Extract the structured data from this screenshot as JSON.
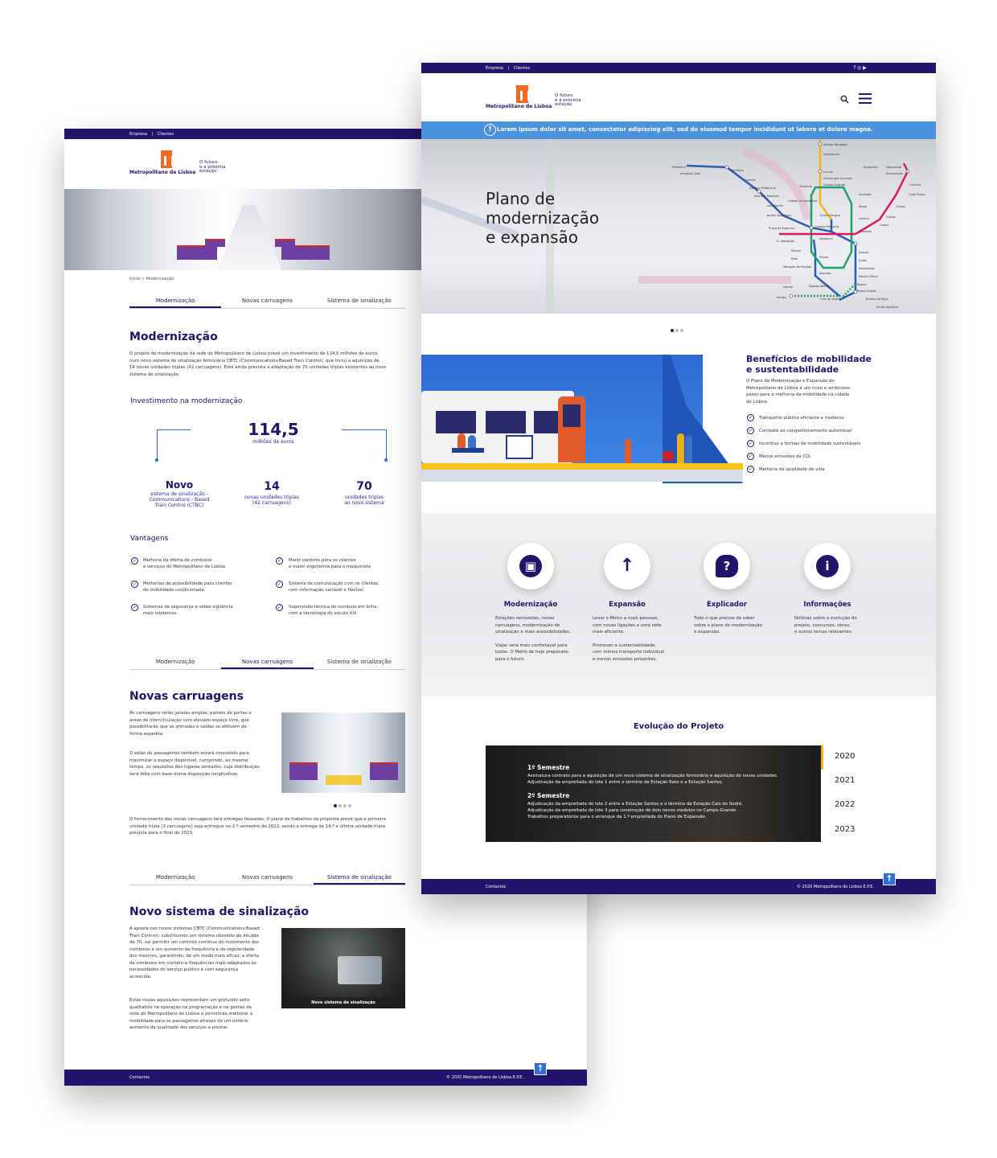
{
  "back": {
    "topbar": {
      "empresa": "Empresa",
      "sep": "|",
      "clientes": "Clientes"
    },
    "logo": {
      "name": "Metropolitano de Lisboa",
      "slogan_1": "O futuro",
      "slogan_2": "é a próxima",
      "slogan_3": "estação"
    },
    "breadcrumb": "Início > Modernização",
    "tabs": [
      "Modernização",
      "Novas carruagens",
      "Sistema de sinalização"
    ],
    "modernizacao": {
      "title": "Modernização",
      "intro": [
        "O projeto de modernização da rede do Metropolitano de Lisboa prevê um investimento de 114,5 milhões de euros",
        "num novo sistema de sinalização ferroviária CBTC (Communications-Based Train Control), que inclui a aquisição de",
        "14 novas unidades triplas (42 carruagens). Está ainda prevista a adaptação de 70 unidades triplas existentes ao novo",
        "sistema de sinalização."
      ],
      "invest_title": "Investimento na modernização",
      "invest_value": "114,5",
      "invest_unit": "milhões de euros",
      "stat1_value": "Novo",
      "stat1_lines": [
        "sistema de sinalização -",
        "Communications - Based",
        "Train Control (CTBC)"
      ],
      "stat2_value": "14",
      "stat2_lines": [
        "novas unidades triplas",
        "(42 carruagens)"
      ],
      "stat3_value": "70",
      "stat3_lines": [
        "unidades triplas",
        "ao novo sistema"
      ],
      "vantagens_title": "Vantagens",
      "vantagens": [
        [
          "Melhoria da oferta de comboios",
          "e serviços do Metropolitano de Lisboa"
        ],
        [
          "Maior conforto para os clientes",
          "e maior ergonomia para o maquinista"
        ],
        [
          "Melhorias de acessibilidade para clientes",
          "de mobilidade condicionada"
        ],
        [
          "Sistema de comunicação com os clientes",
          "com informação variável e flexível"
        ],
        [
          "Sistemas de segurança e vídeo vigilância",
          "mais modernos"
        ],
        [
          "Supervisão técnica do comboio em linha",
          "com a tecnologia do século XXI"
        ]
      ]
    },
    "carruagens": {
      "title": "Novas carruagens",
      "p1": [
        "As carruagens terão janelas amplas, painéis de portas e",
        "áreas de intercirculação com elevado espaço livre, que",
        "possibilitarão que as entradas e saídas se efetuem de",
        "forma expedita."
      ],
      "p2": [
        "O salão de passageiros também estará concebido para",
        "maximizar o espaço disponível, cumprindo, ao mesmo",
        "tempo, os requisitos dos lugares sentados, cuja distribuição",
        "será feita com base numa disposição longitudinal."
      ],
      "p3": [
        "O fornecimento das novas carruagens terá entregas faseadas. O plano de trabalhos da proposta prevê que a primeira",
        "unidade tripla (3 carruagens) seja entregue no 2.º semestre de 2022, sendo a entrega da 14.ª e última unidade tripla",
        "prevista para o final de 2023."
      ]
    },
    "sinalizacao": {
      "title": "Novo sistema de sinalização",
      "p1": [
        "A aposta nos novos sistemas CBTC (Communications-Based",
        "Train Control), substituindo um sistema obsoleto da década",
        "de 70, vai permitir um controlo contínuo do movimento dos",
        "comboios e um aumento da frequência e da regularidade",
        "dos mesmos, garantindo, de um modo mais eficaz, a oferta",
        "de comboios em número e frequências mais adaptados às",
        "necessidades do serviço público e com segurança",
        "acrescida."
      ],
      "p2": [
        "Estas novas aquisições representam um profundo salto",
        "qualitativo na operação na programação e na gestão da",
        "rede do Metropolitano de Lisboa e permitirão melhorar a",
        "mobilidade para os passageiros através de um notório",
        "aumento da qualidade dos serviços a prestar."
      ],
      "caption": "Novo sistema de sinalização"
    },
    "footer": {
      "contactos": "Contactos",
      "copyright": "© 2020 Metropolitano de Lisboa E.P.E."
    }
  },
  "front": {
    "topbar": {
      "empresa": "Empresa",
      "sep": "|",
      "clientes": "Clientes",
      "social": "f  ◎  ▶"
    },
    "alert": "Lorem ipsum dolor sit amet, consectetur adipiscing elit, sed do eiusmod tempor incididunt ut labore et dolore magna.",
    "hero_title": [
      "Plano de",
      "modernização",
      "e expansão"
    ],
    "map_labels": [
      "Senhor Roubado",
      "Odivelas",
      "Ameixoeira",
      "Lumiar",
      "Quinta das Conchas",
      "Campo Grande",
      "Telheiras",
      "Aeroporto",
      "Moscavide",
      "Encarnação",
      "Reboleira",
      "Amadora Este",
      "Alfornelos",
      "Pontinha",
      "Carnide",
      "Colégio Militar/Luz",
      "Alto dos Moinhos",
      "Laranjeiras",
      "Jardim Zoológico",
      "Praça de Espanha",
      "Cidade Universitária",
      "Entre Campos",
      "Campo Pequeno",
      "Saldanha",
      "S. Sebastião",
      "Parque",
      "Rato",
      "Marquês de Pombal",
      "Avenida",
      "Picoas",
      "Alameda",
      "Areeiro",
      "Roma",
      "Alvalade",
      "Olaias",
      "Bela Vista",
      "Chelas",
      "Olivais",
      "Cabo Ruivo",
      "Oriente",
      "Arroios",
      "Anjos",
      "Intendente",
      "Martim Moniz",
      "Rossio",
      "Baixa-Chiado",
      "Restauradores",
      "Cais do Sodré",
      "Terreiro do Paço",
      "Santa Apolónia",
      "Santos",
      "Estrela"
    ],
    "beneficios": {
      "title_1": "Benefícios de mobilidade",
      "title_2": "e sustentabilidade",
      "text": [
        "O Plano de Modernização e Expansão do",
        "Metropolitano de Lisboa é um novo e ambicioso",
        "passo para a melhoria da mobilidade na cidade",
        "de Lisboa."
      ],
      "items": [
        "Transporte público eficiente e moderno",
        "Combate ao congestionamento automóvel",
        "Incentivo a formas de mobilidade sustentáveis",
        "Menos emissões de CO₂",
        "Melhoria da qualidade de vida"
      ]
    },
    "cards": [
      {
        "icon": "metro-icon",
        "glyph": "▣",
        "title": "Modernização",
        "text": [
          "Estações renovadas, novas",
          "carruagens, modernização de",
          "sinalização e mais acessibilidades.",
          "",
          "Viajar será mais confortável para",
          "todos. O Metro de hoje preparado",
          "para o futuro."
        ]
      },
      {
        "icon": "arrow-up-icon",
        "glyph": "↑",
        "title": "Expansão",
        "text": [
          "Levar o Metro a mais pessoas,",
          "com novas ligações e uma rede",
          "mais eficiente.",
          "",
          "Promover a sustentabilidade,",
          "com menos transporte individual",
          "e menos emissões poluentes."
        ]
      },
      {
        "icon": "question-icon",
        "glyph": "?",
        "title": "Explicador",
        "text": [
          "Tudo o que precisa de saber",
          "sobre o plano de modernização",
          "e expansão."
        ]
      },
      {
        "icon": "info-icon",
        "glyph": "i",
        "title": "Informações",
        "text": [
          "Notícias sobre a evolução do",
          "projeto, concursos, obras,",
          "e outros temas relevantes."
        ]
      }
    ],
    "evolucao": {
      "title": "Evolução do Projeto",
      "s1_title": "1º Semestre",
      "s1_lines": [
        "Assinatura contrato para a aquisição de um novo sistema de sinalização ferroviária e aquisição de novas unidades.",
        "Adjudicação da empreitada do lote 1 entre o término da Estação Rato e a Estação Santos."
      ],
      "s2_title": "2º Semestre",
      "s2_lines": [
        "Adjudicação da empreitada do lote 2 entre a Estação Santos e o término da Estação Cais do Sodré.",
        "Adjudicação da empreitada do lote 3 para construção de dois novos viadutos no Campo Grande.",
        "Trabalhos preparatórios para o arranque da 1.ª empreitada do Plano de Expansão."
      ],
      "years": [
        "2020",
        "2021",
        "2022",
        "2023"
      ]
    },
    "footer": {
      "contactos": "Contactos",
      "copyright": "© 2020 Metropolitano de Lisboa E.P.E."
    }
  }
}
